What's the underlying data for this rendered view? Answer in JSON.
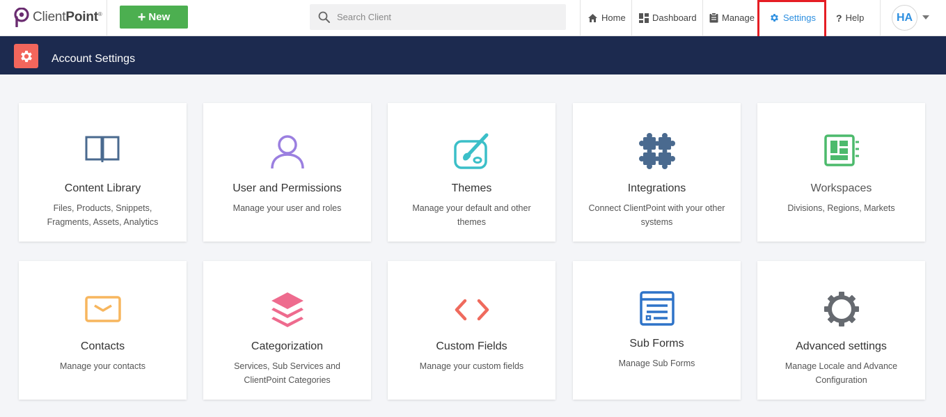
{
  "app": {
    "logo_text_light": "Client",
    "logo_text_bold": "Point",
    "logo_reg": "®"
  },
  "toolbar": {
    "new_label": "New",
    "search_placeholder": "Search Client"
  },
  "nav": {
    "home": "Home",
    "dashboard": "Dashboard",
    "manage": "Manage",
    "settings": "Settings",
    "help": "Help",
    "help_icon": "?",
    "avatar_initials": "HA"
  },
  "page": {
    "title": "Account Settings"
  },
  "cards": [
    {
      "title": "Content Library",
      "desc": "Files, Products, Snippets, Fragments, Assets, Analytics",
      "icon": "book-icon",
      "color": "#4a6a8f"
    },
    {
      "title": "User and Permissions",
      "desc": "Manage your user and roles",
      "icon": "user-icon",
      "color": "#9b7fe0"
    },
    {
      "title": "Themes",
      "desc": "Manage your default and other themes",
      "icon": "palette-icon",
      "color": "#3bbfc8"
    },
    {
      "title": "Integrations",
      "desc": "Connect ClientPoint with your other systems",
      "icon": "puzzle-icon",
      "color": "#4a6a8f"
    },
    {
      "title": "Workspaces",
      "desc": "Divisions, Regions, Markets",
      "icon": "workspace-icon",
      "color": "#4cba6c"
    },
    {
      "title": "Contacts",
      "desc": "Manage your contacts",
      "icon": "envelope-icon",
      "color": "#f7b65e"
    },
    {
      "title": "Categorization",
      "desc": "Services, Sub Services and ClientPoint Categories",
      "icon": "layers-icon",
      "color": "#ee6b8e"
    },
    {
      "title": "Custom Fields",
      "desc": "Manage your custom fields",
      "icon": "code-icon",
      "color": "#ef6a5d"
    },
    {
      "title": "Sub Forms",
      "desc": "Manage Sub Forms",
      "icon": "form-icon",
      "color": "#2e73c8"
    },
    {
      "title": "Advanced settings",
      "desc": "Manage Locale and Advance Configuration",
      "icon": "gear-icon",
      "color": "#666a70"
    }
  ]
}
